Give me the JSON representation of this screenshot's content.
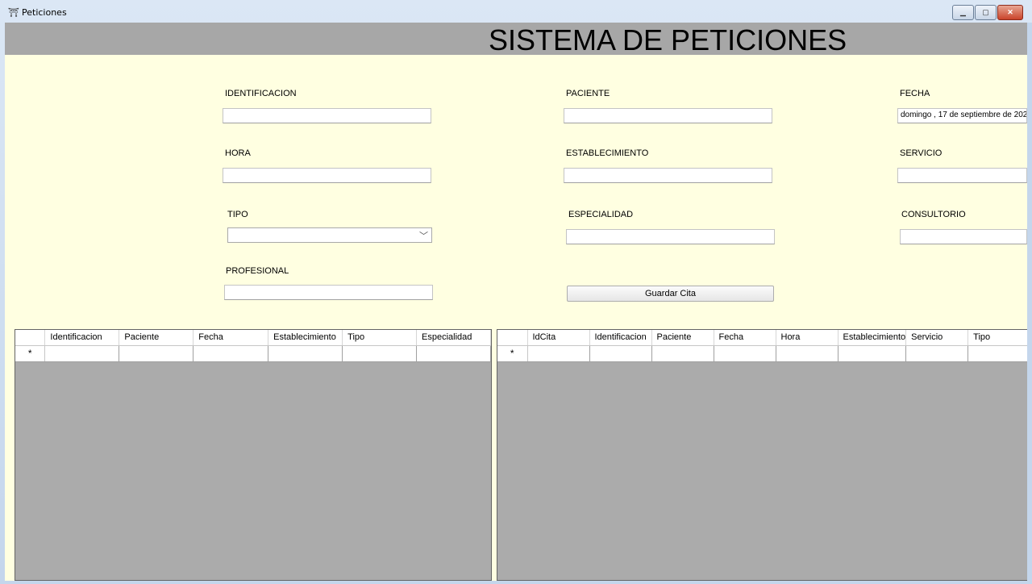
{
  "window": {
    "title": "Peticiones",
    "icon": "app-icon"
  },
  "header": {
    "title": "SISTEMA DE PETICIONES"
  },
  "form": {
    "identificacion": {
      "label": "IDENTIFICACION",
      "value": ""
    },
    "paciente": {
      "label": "PACIENTE",
      "value": ""
    },
    "fecha": {
      "label": "FECHA",
      "value": "domingo , 17 de septiembre de 202"
    },
    "hora": {
      "label": "HORA",
      "value": ""
    },
    "establecimiento": {
      "label": "ESTABLECIMIENTO",
      "value": ""
    },
    "servicio": {
      "label": "SERVICIO",
      "value": ""
    },
    "tipo": {
      "label": "TIPO",
      "value": ""
    },
    "especialidad": {
      "label": "ESPECIALIDAD",
      "value": ""
    },
    "consultorio": {
      "label": "CONSULTORIO",
      "value": ""
    },
    "profesional": {
      "label": "PROFESIONAL",
      "value": ""
    },
    "guardar_label": "Guardar Cita"
  },
  "grid_left": {
    "columns": [
      "Identificacion",
      "Paciente",
      "Fecha",
      "Establecimiento",
      "Tipo",
      "Especialidad"
    ],
    "new_row_marker": "*"
  },
  "grid_right": {
    "columns": [
      "IdCita",
      "Identificacion",
      "Paciente",
      "Fecha",
      "Hora",
      "Establecimiento",
      "Servicio",
      "Tipo"
    ],
    "new_row_marker": "*"
  }
}
